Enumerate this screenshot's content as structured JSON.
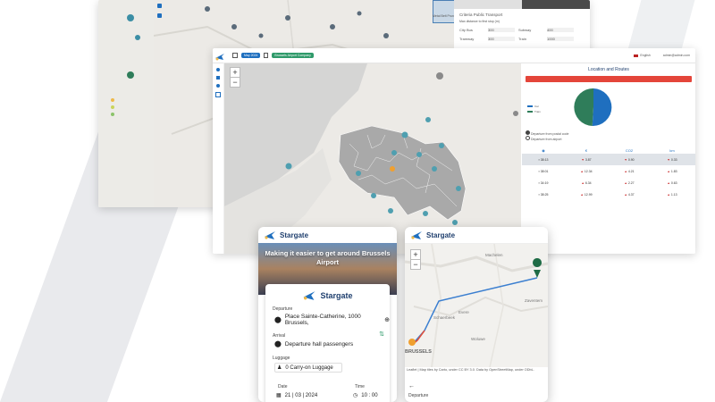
{
  "back_panel": {
    "criteria_title": "Criteria Public Transport",
    "max_distance": "Max distance to first stop (m)",
    "rows": [
      {
        "a": "City Bus",
        "av": "300",
        "b": "Subway",
        "bv": "400"
      },
      {
        "a": "Tramway",
        "av": "300",
        "b": "Train",
        "bv": "1000"
      }
    ],
    "thumb_caption": "Metal Belt Pruned"
  },
  "dashboard": {
    "date_badge": "May 2024",
    "org_badge": "Brussels Airport Company",
    "language": "English",
    "user": "admin@admin.com",
    "panel_title": "Location and Routes",
    "cancel_button": "Cancel selection",
    "legend": [
      {
        "label": "Car",
        "color": "#1f6fbf"
      },
      {
        "label": "Train",
        "color": "#2f7d5a"
      }
    ],
    "pie": {
      "values": [
        52,
        48
      ],
      "colors": [
        "#1f6fbf",
        "#2f7d5a"
      ]
    },
    "radio": [
      "Departure from postal code",
      "Departure from airport"
    ],
    "columns": [
      "",
      "€",
      "CO2",
      "km"
    ],
    "rows": [
      {
        "t": "38:13",
        "eur": "3.87",
        "co2": "0.90",
        "km": "0.33",
        "hl": true
      },
      {
        "t": "38:01",
        "eur": "12.34",
        "co2": "4.21",
        "km": "1.83",
        "hl": false
      },
      {
        "t": "34:19",
        "eur": "6.34",
        "co2": "2.27",
        "km": "0.63",
        "hl": false
      },
      {
        "t": "38:25",
        "eur": "12.99",
        "co2": "4.37",
        "km": "1.13",
        "hl": false
      }
    ]
  },
  "phone_left": {
    "brand": "Stargate",
    "hero": "Making it easier to get around Brussels Airport",
    "card_brand": "Stargate",
    "departure_label": "Departure",
    "departure_value": "Place Sainte-Catherine, 1000 Brussels,",
    "arrival_label": "Arrival",
    "arrival_value": "Departure hall passengers",
    "luggage_label": "Luggage",
    "luggage_value": "0 Carry-on Luggage",
    "date_label": "Date",
    "date_value": "21 | 03 | 2024",
    "time_label": "Time",
    "time_value": "10 : 00"
  },
  "phone_right": {
    "brand": "Stargate",
    "places": [
      "Machelen",
      "Zaventem",
      "Evere",
      "Schaerbeek",
      "Woluwe",
      "BRUSSELS"
    ],
    "attribution": "Leaflet | Map tiles by Carto, under CC BY 3.0. Data by OpenStreetMap, under ODbL.",
    "departure_label": "Departure",
    "colors": {
      "route": "#3b7fd0",
      "origin": "#f0a030",
      "dest": "#1e6b45"
    }
  }
}
